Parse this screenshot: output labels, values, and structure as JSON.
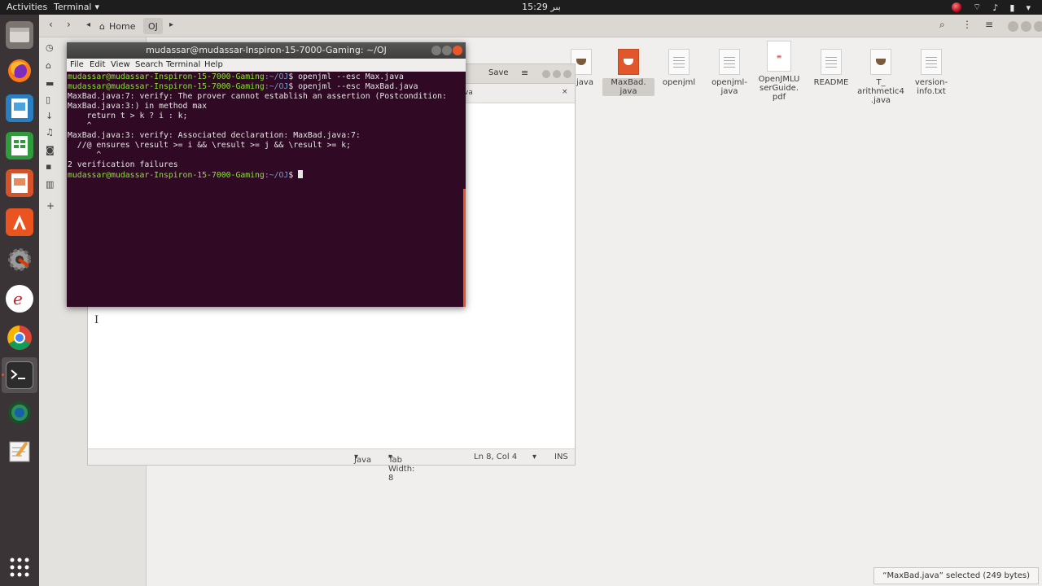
{
  "topbar": {
    "activities": "Activities",
    "app_name": "Terminal",
    "clock": "15:29 بىر"
  },
  "dock": {
    "items": [
      "files-icon",
      "firefox-icon",
      "image-viewer-icon",
      "calc-icon",
      "impress-icon",
      "software-icon",
      "settings-icon",
      "eclipse-icon",
      "chrome-icon",
      "terminal-icon",
      "globe-icon",
      "editor-icon",
      "app-grid-icon"
    ]
  },
  "files": {
    "path": {
      "home": "Home",
      "current": "OJ"
    },
    "icons": [
      {
        "label": "k.java",
        "type": "cup"
      },
      {
        "label": "MaxBad.\njava",
        "type": "cup-orange",
        "selected": true
      },
      {
        "label": "openjml",
        "type": "doc"
      },
      {
        "label": "openjml-\njava",
        "type": "doc"
      },
      {
        "label": "OpenJMLU\nserGuide.\npdf",
        "type": "pdf"
      },
      {
        "label": "README",
        "type": "doc"
      },
      {
        "label": "T_\narithmetic4\n.java",
        "type": "cup"
      },
      {
        "label": "version-\ninfo.txt",
        "type": "doc"
      }
    ],
    "status": "“MaxBad.java” selected (249 bytes)"
  },
  "gedit": {
    "save": "Save",
    "tab": "va",
    "status": {
      "lang": "Java",
      "tab_width": "Tab Width: 8",
      "position": "Ln 8, Col 4",
      "mode": "INS"
    }
  },
  "terminal": {
    "title": "mudassar@mudassar-Inspiron-15-7000-Gaming: ~/OJ",
    "menu": [
      "File",
      "Edit",
      "View",
      "Search",
      "Terminal",
      "Help"
    ],
    "prompt_user": "mudassar@mudassar-Inspiron-15-7000-Gaming",
    "prompt_path": ":~/OJ",
    "lines": [
      {
        "kind": "cmd",
        "text": "$ openjml --esc Max.java"
      },
      {
        "kind": "cmd",
        "text": "$ openjml --esc MaxBad.java"
      },
      {
        "kind": "out",
        "text": "MaxBad.java:7: verify: The prover cannot establish an assertion (Postcondition:"
      },
      {
        "kind": "out",
        "text": "MaxBad.java:3:) in method max"
      },
      {
        "kind": "out",
        "text": "    return t > k ? i : k;"
      },
      {
        "kind": "out",
        "text": "    ^"
      },
      {
        "kind": "out",
        "text": "MaxBad.java:3: verify: Associated declaration: MaxBad.java:7:"
      },
      {
        "kind": "out",
        "text": "  //@ ensures \\result >= i && \\result >= j && \\result >= k;"
      },
      {
        "kind": "out",
        "text": "      ^"
      },
      {
        "kind": "out",
        "text": "2 verification failures"
      },
      {
        "kind": "cmd",
        "text": "$ "
      }
    ]
  }
}
